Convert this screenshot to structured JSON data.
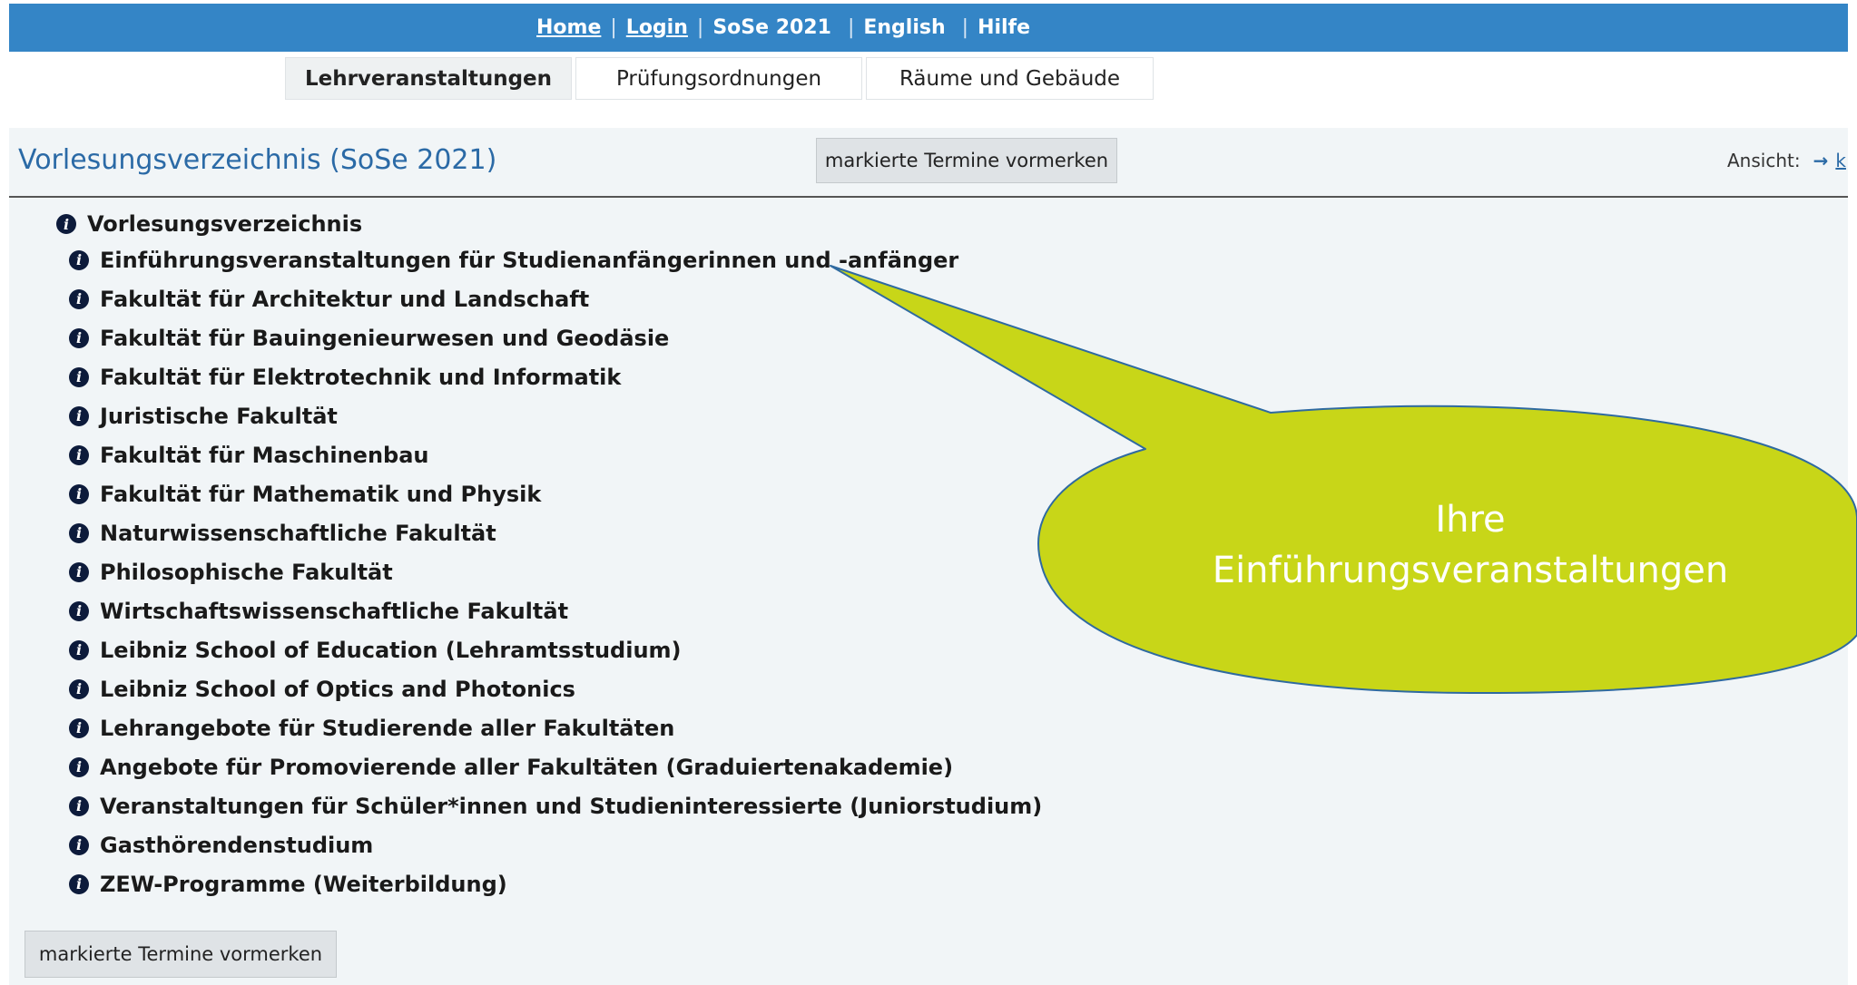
{
  "topnav": {
    "home": "Home",
    "login": "Login",
    "semester": "SoSe 2021",
    "english": "English",
    "help": "Hilfe",
    "separator": "|"
  },
  "tabs": [
    {
      "label": "Lehrveranstaltungen",
      "active": true
    },
    {
      "label": "Prüfungsordnungen",
      "active": false
    },
    {
      "label": "Räume und Gebäude",
      "active": false
    }
  ],
  "header": {
    "title": "Vorlesungsverzeichnis (SoSe 2021)",
    "mark_button": "markierte Termine vormerken",
    "view_label": "Ansicht:",
    "view_link": "k"
  },
  "tree": {
    "root": "Vorlesungsverzeichnis",
    "items": [
      "Einführungsveranstaltungen für Studienanfängerinnen und -anfänger",
      "Fakultät für Architektur und Landschaft",
      "Fakultät für Bauingenieurwesen und Geodäsie",
      "Fakultät für Elektrotechnik und Informatik",
      "Juristische Fakultät",
      "Fakultät für Maschinenbau",
      "Fakultät für Mathematik und Physik",
      "Naturwissenschaftliche Fakultät",
      "Philosophische Fakultät",
      "Wirtschaftswissenschaftliche Fakultät",
      "Leibniz School of Education (Lehramtsstudium)",
      "Leibniz School of Optics and Photonics",
      "Lehrangebote für Studierende aller Fakultäten",
      "Angebote für Promovierende aller Fakultäten (Graduiertenakademie)",
      "Veranstaltungen für Schüler*innen und Studieninteressierte (Juniorstudium)",
      "Gasthörendenstudium",
      "ZEW-Programme (Weiterbildung)"
    ]
  },
  "footer": {
    "mark_button": "markierte Termine vormerken"
  },
  "callout": {
    "line1": "Ihre",
    "line2": "Einführungsveranstaltungen",
    "fill_color": "#c8d618",
    "stroke_color": "#2f6aa0"
  },
  "colors": {
    "topbar": "#3485c6",
    "title": "#2b6aa6",
    "panel": "#f1f5f7",
    "info_icon": "#0d1b3b"
  },
  "icons": {
    "info": "info-circle-icon",
    "view_arrow": "arrow-right-icon"
  }
}
